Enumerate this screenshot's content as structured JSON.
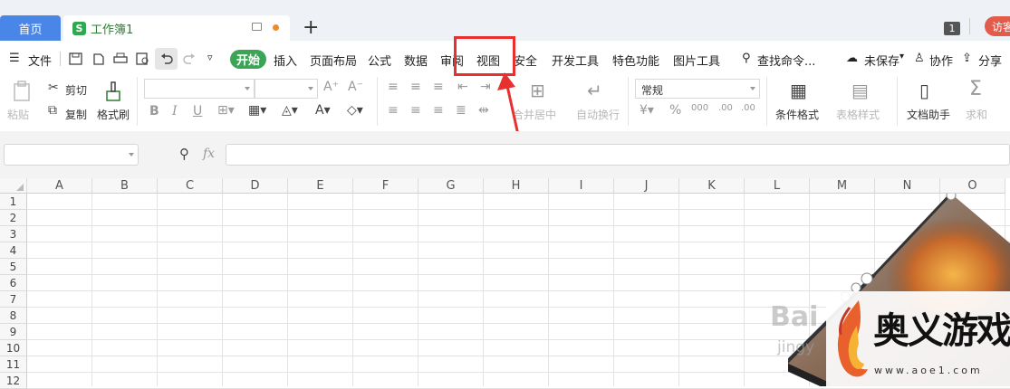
{
  "tabs": {
    "home": "首页",
    "doc": "工作簿1",
    "doc_icon": "S",
    "add": "+",
    "page_count": "1",
    "visitor": "访客"
  },
  "menu": {
    "file": "文件",
    "items": [
      "开始",
      "插入",
      "页面布局",
      "公式",
      "数据",
      "审阅",
      "视图",
      "安全",
      "开发工具",
      "特色功能",
      "图片工具"
    ],
    "search": "查找命令...",
    "unsaved": "未保存",
    "collab": "协作",
    "share": "分享"
  },
  "ribbon": {
    "paste": "粘贴",
    "cut": "剪切",
    "copy": "复制",
    "format_painter": "格式刷",
    "number_format": "常规",
    "merge_center": "合并居中",
    "auto_wrap": "自动换行",
    "conditional_format": "条件格式",
    "table_style": "表格样式",
    "doc_assistant": "文档助手",
    "sum": "求和"
  },
  "formula_bar": {
    "fx": "fx"
  },
  "grid": {
    "columns": [
      "A",
      "B",
      "C",
      "D",
      "E",
      "F",
      "G",
      "H",
      "I",
      "J",
      "K",
      "L",
      "M",
      "N",
      "O"
    ],
    "rows": [
      "1",
      "2",
      "3",
      "4",
      "5",
      "6",
      "7",
      "8",
      "9",
      "10",
      "11",
      "12"
    ]
  },
  "watermark": {
    "title": "奥义游戏网",
    "url": "www.aoe1.com",
    "baidu": "Bai",
    "baidu_sub": "jingy"
  },
  "colors": {
    "accent_green": "#3aa655",
    "home_tab": "#4a86e8",
    "annotation_red": "#e8312e"
  }
}
